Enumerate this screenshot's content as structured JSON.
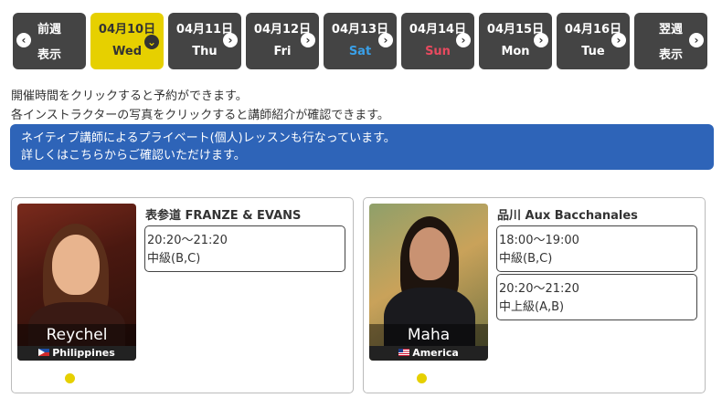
{
  "date_nav": {
    "prev": {
      "line1": "前週",
      "line2": "表示"
    },
    "days": [
      {
        "date": "04月10日",
        "weekday": "Wed",
        "selected": true
      },
      {
        "date": "04月11日",
        "weekday": "Thu"
      },
      {
        "date": "04月12日",
        "weekday": "Fri"
      },
      {
        "date": "04月13日",
        "weekday": "Sat"
      },
      {
        "date": "04月14日",
        "weekday": "Sun"
      },
      {
        "date": "04月15日",
        "weekday": "Mon"
      },
      {
        "date": "04月16日",
        "weekday": "Tue"
      }
    ],
    "next": {
      "line1": "翌週",
      "line2": "表示"
    }
  },
  "info": {
    "line1": "開催時間をクリックすると予約ができます。",
    "line2": "各インストラクターの写真をクリックすると講師紹介が確認できます。"
  },
  "banner": {
    "line1": "ネイティブ講師によるプライベート(個人)レッスンも行なっています。",
    "line2": "詳しくはこちらからご確認いただけます。"
  },
  "colors": {
    "accent": "#e6d000",
    "banner": "#2e64b8",
    "tab": "#444444",
    "saturday": "#3aa0e8",
    "sunday": "#e84a5f"
  },
  "cards": [
    {
      "instructor": "Reychel",
      "country": "Philippines",
      "venue": "表参道 FRANZE & EVANS",
      "slots": [
        {
          "time": "20:20～21:20",
          "level": "中級(B,C)"
        }
      ]
    },
    {
      "instructor": "Maha",
      "country": "America",
      "venue": "品川 Aux Bacchanales",
      "slots": [
        {
          "time": "18:00～19:00",
          "level": "中級(B,C)"
        },
        {
          "time": "20:20～21:20",
          "level": "中上級(A,B)"
        }
      ]
    }
  ]
}
